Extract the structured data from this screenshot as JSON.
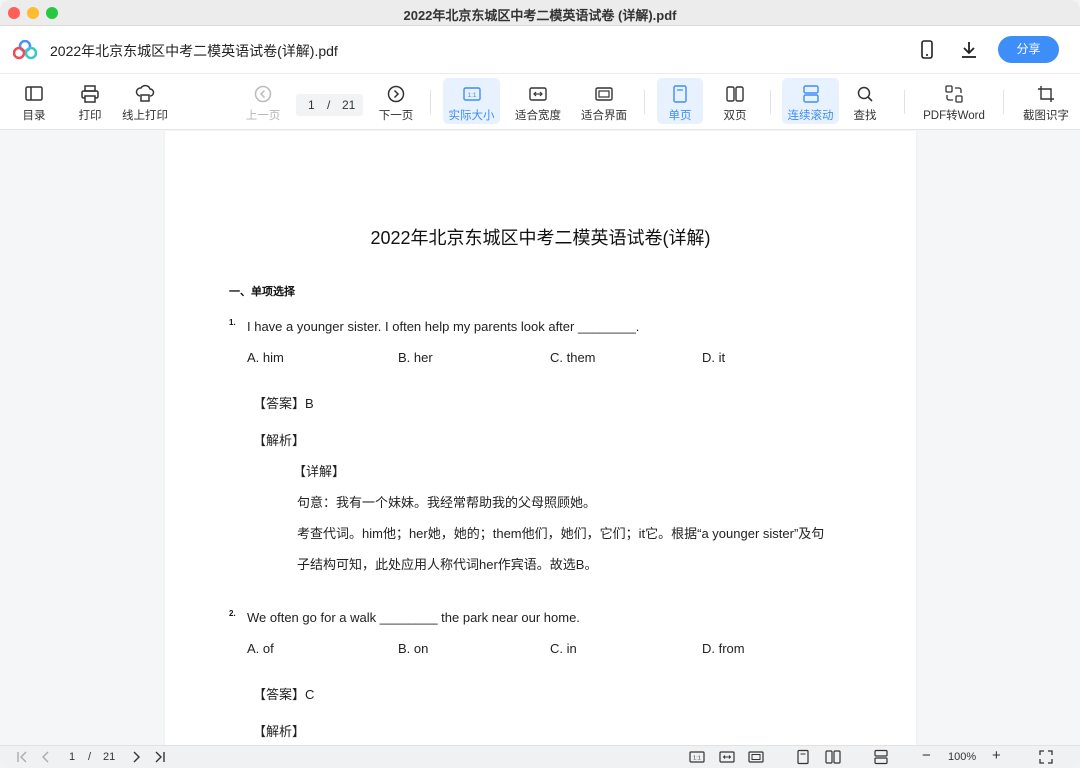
{
  "window": {
    "title": "2022年北京东城区中考二模英语试卷 (详解).pdf"
  },
  "header": {
    "file_title": "2022年北京东城区中考二模英语试卷(详解).pdf",
    "share_label": "分享"
  },
  "toolbar": {
    "toc": "目录",
    "print": "打印",
    "online_print": "线上打印",
    "prev_page": "上一页",
    "current_page": "1",
    "page_sep": "/",
    "total_pages": "21",
    "next_page": "下一页",
    "actual_size": "实际大小",
    "actual_size_icon_text": "1:1",
    "fit_width": "适合宽度",
    "fit_page": "适合界面",
    "single_page": "单页",
    "double_page": "双页",
    "continuous_scroll": "连续滚动",
    "search": "查找",
    "pdf_to_word": "PDF转Word",
    "ocr": "截图识字"
  },
  "document": {
    "title": "2022年北京东城区中考二模英语试卷(详解)",
    "section_title": "一、单项选择",
    "questions": [
      {
        "number": "1.",
        "text": "I have a younger sister. I often help my parents look after ________.",
        "options": [
          "A. him",
          "B. her",
          "C. them",
          "D. it"
        ],
        "answer": "【答案】B",
        "analysis_label": "【解析】",
        "detail_label": "【详解】",
        "detail_lines": [
          "句意：我有一个妹妹。我经常帮助我的父母照顾她。",
          "考查代词。him他；her她，她的；them他们，她们，它们；it它。根据“a younger sister”及句",
          "子结构可知，此处应用人称代词her作宾语。故选B。"
        ]
      },
      {
        "number": "2.",
        "text": "We often go for a walk ________ the park near our home.",
        "options": [
          "A. of",
          "B. on",
          "C. in",
          "D. from"
        ],
        "answer": "【答案】C",
        "analysis_label": "【解析】"
      }
    ]
  },
  "bottombar": {
    "current_page": "1",
    "page_sep": "/",
    "total_pages": "21",
    "actual_size_icon_text": "1:1",
    "zoom": "100%",
    "zoom_out": "−",
    "zoom_in": "+"
  },
  "colors": {
    "accent": "#3d8ef8",
    "active_bg": "#e8f1fe"
  }
}
